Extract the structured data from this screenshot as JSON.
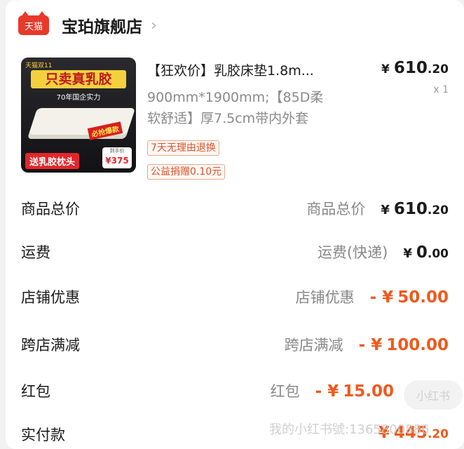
{
  "shop": {
    "badge": "天猫",
    "name": "宝珀旗舰店",
    "chevron": "›"
  },
  "product": {
    "thumb": {
      "top_tag": "天猫双11",
      "banner": "只卖真乳胶",
      "subtitle": "70年国企实力",
      "burst": "必抢爆款",
      "gift": "送乳胶枕头",
      "sticker_label": "到手价",
      "sticker_price": "¥375"
    },
    "title": "【狂欢价】乳胶床垫1.8m...",
    "spec_line1": "900mm*1900mm;【85D柔",
    "spec_line2": "软舒适】厚7.5cm带内外套",
    "tags": [
      "7天无理由退换",
      "公益捐赠0.10元"
    ],
    "price": {
      "currency": "¥",
      "integer": "610",
      "decimal": ".20"
    },
    "quantity": "x 1"
  },
  "summary": [
    {
      "label": "商品总价",
      "sublabel": "商品总价",
      "prefix": "",
      "currency": "¥",
      "integer": "610",
      "decimal": ".20",
      "orange": false
    },
    {
      "label": "运费",
      "sublabel": "运费(快递)",
      "prefix": "",
      "currency": "¥",
      "integer": "0",
      "decimal": ".00",
      "orange": false
    },
    {
      "label": "店铺优惠",
      "sublabel": "店铺优惠",
      "prefix": "- ",
      "currency": "¥",
      "integer": "50",
      "decimal": ".00",
      "orange": true
    },
    {
      "label": "跨店满减",
      "sublabel": "跨店满减",
      "prefix": "- ",
      "currency": "¥",
      "integer": "100",
      "decimal": ".00",
      "orange": true
    },
    {
      "label": "红包",
      "sublabel": "红包",
      "prefix": "- ",
      "currency": "¥",
      "integer": "15",
      "decimal": ".00",
      "orange": true
    },
    {
      "label": "实付款",
      "sublabel": "",
      "prefix": "",
      "currency": "¥",
      "integer": "445",
      "decimal": ".20",
      "orange": true
    }
  ],
  "watermark": {
    "pill": "小红书",
    "text": "我的小红书號:1365800886"
  }
}
